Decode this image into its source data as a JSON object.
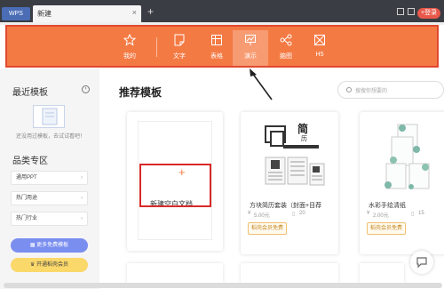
{
  "titlebar": {
    "logo": "WPS",
    "tab_title": "新建",
    "tab_close": "×",
    "new_tab": "+",
    "login_button": "+登录"
  },
  "toolbar": {
    "items": [
      {
        "label": "我的",
        "icon": "star-icon"
      },
      {
        "label": "文字",
        "icon": "document-icon"
      },
      {
        "label": "表格",
        "icon": "table-icon"
      },
      {
        "label": "演示",
        "icon": "presentation-icon"
      },
      {
        "label": "脑图",
        "icon": "mindmap-icon"
      },
      {
        "label": "H5",
        "icon": "h5-icon"
      }
    ],
    "active_index": 3,
    "accent": "#f47a44"
  },
  "sidebar": {
    "recent_title": "最近模板",
    "empty_text": "还没用过模板，去试试看吧！",
    "category_title": "品类专区",
    "categories": [
      "通用PPT",
      "热门用途",
      "热门行业"
    ],
    "free_button": "更多免费模板",
    "member_button": "开通稻壳会员"
  },
  "main": {
    "title": "推荐模板",
    "search_placeholder": "搜搜你想要的",
    "blank_card_label": "新建空白文档",
    "templates": [
      {
        "name": "方块简历套装（封面+目荐",
        "price": "5.00元",
        "downloads": "20",
        "badge": "稻壳会员免费",
        "heading": "简",
        "subheading": "历"
      },
      {
        "name": "水彩手绘清纸",
        "price": "2.00元",
        "downloads": "15",
        "badge": "稻壳会员免费"
      }
    ]
  }
}
